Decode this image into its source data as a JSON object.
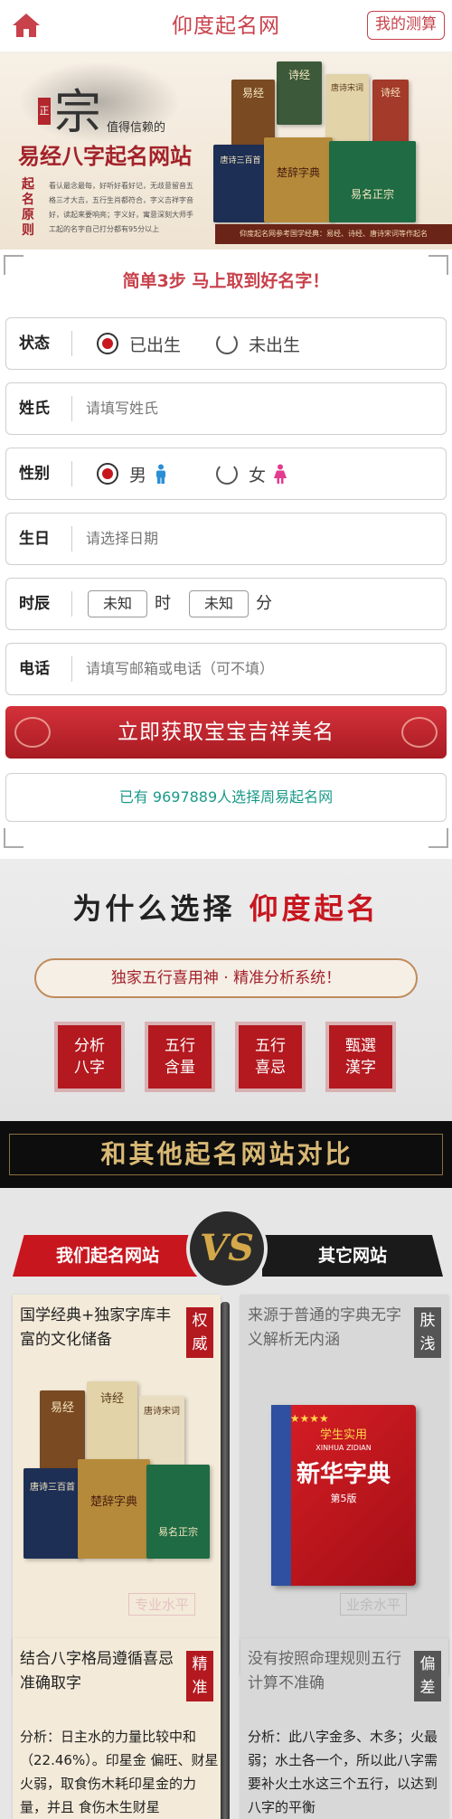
{
  "header": {
    "site_title": "仰度起名网",
    "my_test_label": "我的测算"
  },
  "banner": {
    "seal_char": "正",
    "zong_char": "宗",
    "trust_text": "值得信赖的",
    "headline": "易经八字起名网站",
    "vertical_label": "起名原则",
    "description": "看认最念最每，好听好看好记，无歧意留音五格三才大吉，五行生肖都符合，字义吉祥字音好，读起来要响亮；字义好，寓意深刻大师手工起的名字自己打分都有95分以上",
    "books": [
      "诗经",
      "易经",
      "唐诗宋词",
      "诗经",
      "唐诗三百首",
      "楚辞字典",
      "易名正宗"
    ],
    "strip_text": "仰度起名网参考国学经典：易经、诗经、唐诗宋词等作起名"
  },
  "form": {
    "steps_title": "简单3步 马上取到好名字！",
    "status": {
      "label": "状态",
      "options": [
        "已出生",
        "未出生"
      ],
      "selected": "已出生"
    },
    "surname": {
      "label": "姓氏",
      "placeholder": "请填写姓氏"
    },
    "gender": {
      "label": "性别",
      "options": [
        "男",
        "女"
      ],
      "selected": "男",
      "male_icon": "male-person-icon",
      "female_icon": "female-person-icon"
    },
    "birthday": {
      "label": "生日",
      "placeholder": "请选择日期"
    },
    "hour": {
      "label": "时辰",
      "hour_value": "未知",
      "hour_unit": "时",
      "minute_value": "未知",
      "minute_unit": "分"
    },
    "phone": {
      "label": "电话",
      "placeholder": "请填写邮箱或电话（可不填）"
    },
    "submit_label": "立即获取宝宝吉祥美名",
    "count_text": "已有 9697889人选择周易起名网"
  },
  "why": {
    "title_dark": "为什么选择",
    "title_red": "仰度起名",
    "pill_text": "独家五行喜用神 · 精准分析系统！",
    "tiles": [
      {
        "line1": "分析",
        "line2": "八字"
      },
      {
        "line1": "五行",
        "line2": "含量"
      },
      {
        "line1": "五行",
        "line2": "喜忌"
      },
      {
        "line1": "甄選",
        "line2": "漢字"
      }
    ]
  },
  "compare": {
    "banner_title": "和其他起名网站对比",
    "tab_ours": "我们起名网站",
    "tab_others": "其它网站",
    "vs_text": "VS",
    "ours_card1": "国学经典+独家字库丰富的文化储备",
    "ours_badge1": "权威",
    "others_card1": "来源于普通的字典无字义解析无内涵",
    "others_badge1": "肤浅",
    "ours_watermark": "专业水平",
    "others_watermark": "业余水平",
    "dict_top": "学生实用",
    "dict_title": "新华字典",
    "dict_pinyin": "XINHUA ZIDIAN",
    "dict_edition": "第5版",
    "ours_card2": "结合八字格局遵循喜忌准确取字",
    "ours_badge2": "精准",
    "others_card2": "没有按照命理规则五行计算不准确",
    "others_badge2": "偏差",
    "ours_analysis": "分析：日主水的力量比较中和（22.46%）。印星金 偏旺、财星火弱，取食伤木耗印星金的力量，并且 食伤木生财星",
    "others_analysis": "分析：此八字金多、木多；火最弱；水土各一个，所以此八字需要补火土水这三个五行，以达到八字的平衡"
  },
  "colors": {
    "brand_red": "#c8414b",
    "deep_red": "#b3191f",
    "teal": "#1a9a8a",
    "gold": "#d8b874"
  }
}
